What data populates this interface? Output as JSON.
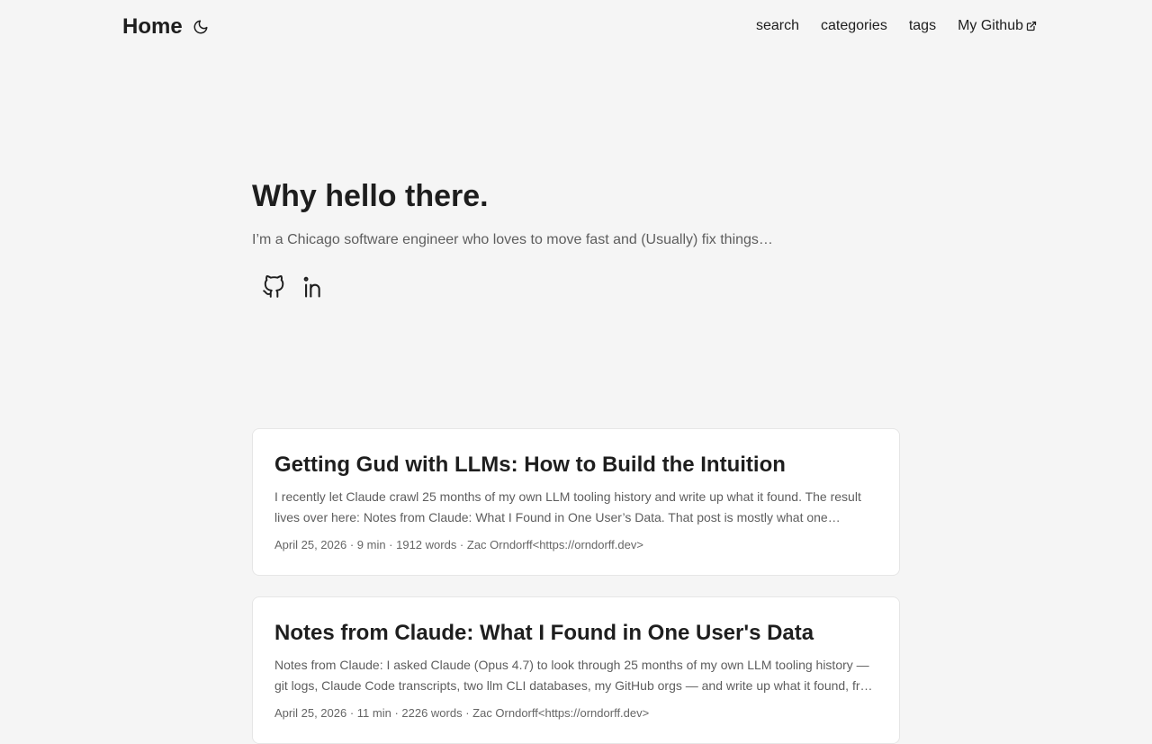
{
  "header": {
    "logo": "Home",
    "menu": [
      {
        "label": "search"
      },
      {
        "label": "categories"
      },
      {
        "label": "tags"
      },
      {
        "label": "My Github"
      }
    ]
  },
  "hero": {
    "title": "Why hello there.",
    "subtitle": "I’m a Chicago software engineer who loves to move fast and (Usually) fix things…"
  },
  "posts": [
    {
      "title": "Getting Gud with LLMs: How to Build the Intuition",
      "summary": "I recently let Claude crawl 25 months of my own LLM tooling history and write up what it found. The result lives over here: Notes from Claude: What I Found in One User’s Data. That post is mostly what one…",
      "meta": "April 25, 2026 · 9 min · 1912 words · Zac Orndorff<https://orndorff.dev>"
    },
    {
      "title": "Notes from Claude: What I Found in One User's Data",
      "summary": "Notes from Claude: I asked Claude (Opus 4.7) to look through 25 months of my own LLM tooling history — git logs, Claude Code transcripts, two llm CLI databases, my GitHub orgs — and write up what it found, fr…",
      "meta": "April 25, 2026 · 11 min · 2226 words · Zac Orndorff<https://orndorff.dev>"
    }
  ]
}
